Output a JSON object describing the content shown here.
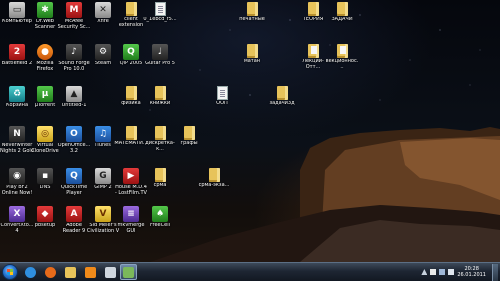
{
  "desktop": {
    "icons": [
      {
        "label": "Компьютер",
        "icon": "computer-icon"
      },
      {
        "label": "Dr.Web Scanner",
        "icon": "drweb-icon"
      },
      {
        "label": "McAfee Security Sc...",
        "icon": "mcafee-icon"
      },
      {
        "label": "Xfire",
        "icon": "xfire-icon"
      },
      {
        "label": "client extension",
        "icon": "folder-icon"
      },
      {
        "label": "0_1ebcd_f5...",
        "icon": "document-icon"
      },
      {
        "label": "печатные",
        "icon": "folder-icon"
      },
      {
        "label": "ТЕОРИЯ",
        "icon": "folder-icon"
      },
      {
        "label": "ЗАДАЧИ",
        "icon": "folder-icon"
      },
      {
        "label": "Battlefield 2",
        "icon": "battlefield-icon"
      },
      {
        "label": "Mozilla Firefox",
        "icon": "firefox-icon"
      },
      {
        "label": "Sound Forge Pro 10.0",
        "icon": "soundforge-icon"
      },
      {
        "label": "Steam",
        "icon": "steam-icon"
      },
      {
        "label": "QIP 2005",
        "icon": "qip-icon"
      },
      {
        "label": "Guitar Pro 5",
        "icon": "guitarpro-icon"
      },
      {
        "label": "матан",
        "icon": "folder-icon"
      },
      {
        "label": "Лекции-Отт...",
        "icon": "folder-document-icon"
      },
      {
        "label": "векционнос...",
        "icon": "folder-document-icon"
      },
      {
        "label": "Корзина",
        "icon": "recycle-bin-icon"
      },
      {
        "label": "µTorrent",
        "icon": "utorrent-icon"
      },
      {
        "label": "Untitled-1",
        "icon": "image-file-icon"
      },
      {
        "label": "физика",
        "icon": "folder-icon"
      },
      {
        "label": "книжки",
        "icon": "folder-icon"
      },
      {
        "label": "ООП",
        "icon": "document-icon"
      },
      {
        "label": "задачи3д",
        "icon": "folder-icon"
      },
      {
        "label": "Neverwinter Nights 2 Gold",
        "icon": "neverwinter-icon"
      },
      {
        "label": "Virtual CloneDrive",
        "icon": "clonedrive-icon"
      },
      {
        "label": "OpenOffice... 3.2",
        "icon": "openoffice-icon"
      },
      {
        "label": "iTunes",
        "icon": "itunes-icon"
      },
      {
        "label": "МАТЕМАТИ...",
        "icon": "folder-icon"
      },
      {
        "label": "дискретка-к...",
        "icon": "folder-icon"
      },
      {
        "label": "графы",
        "icon": "folder-icon"
      },
      {
        "label": "Play BF2 Online Now!",
        "icon": "bf2-online-icon"
      },
      {
        "label": "DNS",
        "icon": "dns-icon"
      },
      {
        "label": "QuickTime Player",
        "icon": "quicktime-icon"
      },
      {
        "label": "GIMP 2",
        "icon": "gimp-icon"
      },
      {
        "label": "House M.D.4 - LostFilm.TV",
        "icon": "video-file-icon"
      },
      {
        "label": "срма",
        "icon": "folder-icon"
      },
      {
        "label": "срма-экза...",
        "icon": "folder-icon"
      },
      {
        "label": "ConvertXto... 4",
        "icon": "convertx-icon"
      },
      {
        "label": "pbsetup",
        "icon": "pbsetup-icon"
      },
      {
        "label": "Adobe Reader 9",
        "icon": "adobe-reader-icon"
      },
      {
        "label": "Sid Meier's Civilization V",
        "icon": "civilization-icon"
      },
      {
        "label": "mkvmerge GUI",
        "icon": "mkvmerge-icon"
      },
      {
        "label": "FreeCell",
        "icon": "freecell-icon"
      }
    ]
  },
  "taskbar": {
    "pinned": [
      {
        "name": "internet-explorer",
        "icon": "internet-explorer-icon",
        "color": "#2f8fe0"
      },
      {
        "name": "firefox",
        "icon": "firefox-icon",
        "color": "#e66a1a"
      },
      {
        "name": "explorer",
        "icon": "folder-icon",
        "color": "#e7c35a"
      },
      {
        "name": "media-player",
        "icon": "media-player-icon",
        "color": "#f08a1a"
      },
      {
        "name": "calculator",
        "icon": "calculator-icon",
        "color": "#cfd6de"
      },
      {
        "name": "active-window",
        "icon": "window-icon",
        "color": "#7bb85a"
      }
    ],
    "clock": {
      "time": "20:28",
      "date": "26.01.2011"
    }
  }
}
